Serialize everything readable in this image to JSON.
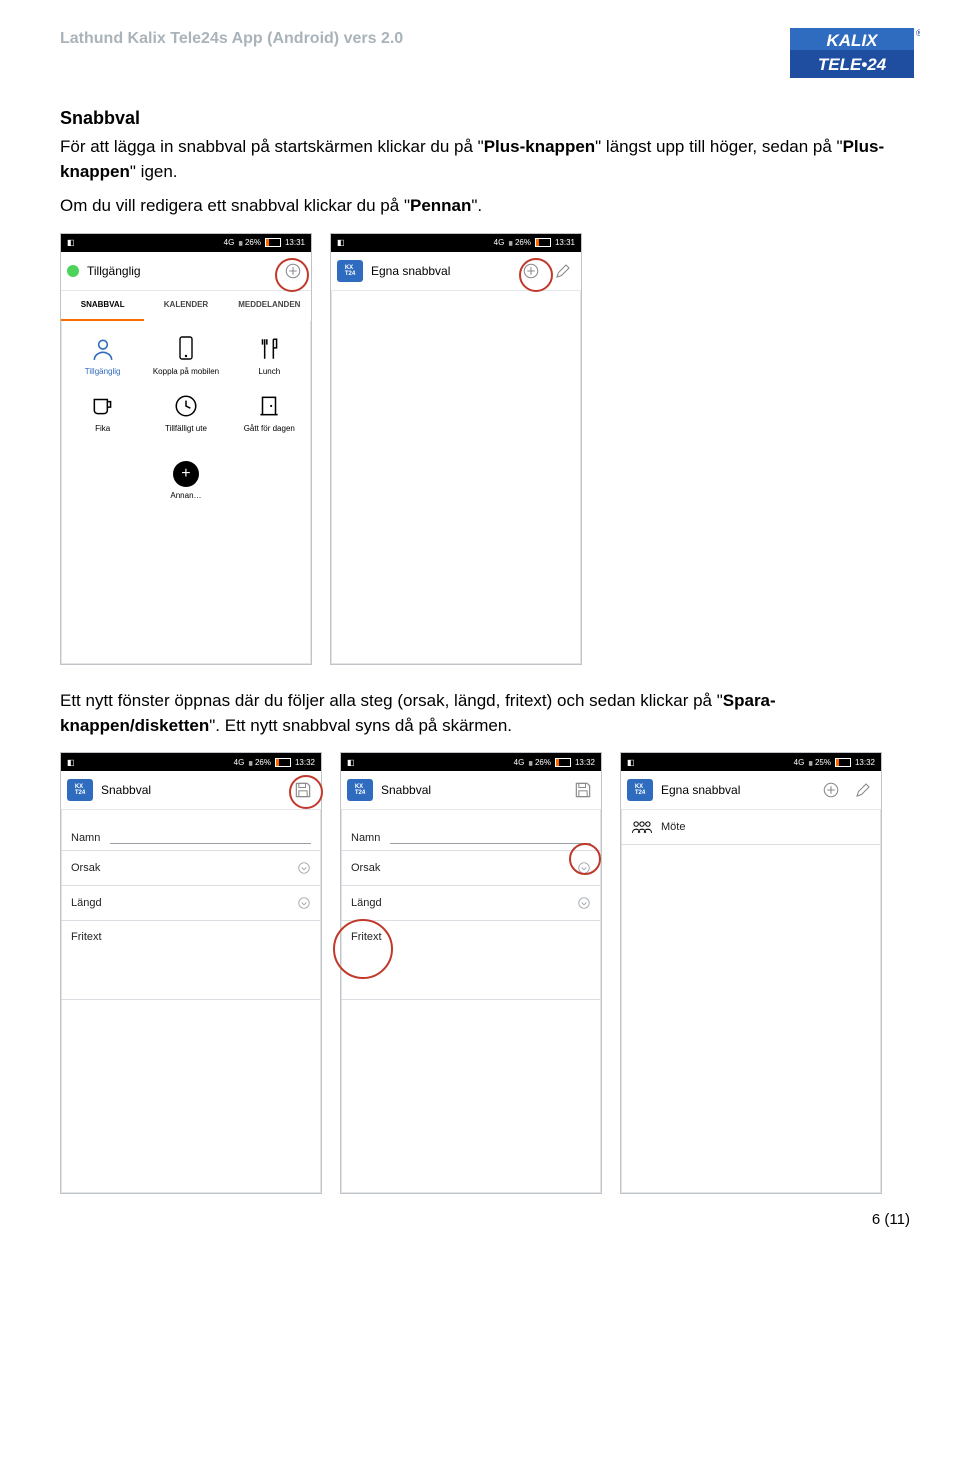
{
  "doc_header": "Lathund Kalix Tele24s App (Android) vers 2.0",
  "logo": {
    "line1": "KALIX",
    "line2": "TELE•24"
  },
  "section1": {
    "title": "Snabbval",
    "p1a": "För att lägga in snabbval på startskärmen klickar du på \"",
    "p1b": "Plus-knappen",
    "p1c": "\" längst upp till höger, sedan på \"",
    "p1d": "Plus-knappen",
    "p1e": "\" igen.",
    "p2a": "Om du vill redigera ett snabbval klickar du på \"",
    "p2b": "Pennan",
    "p2c": "\"."
  },
  "section2": {
    "p1a": "Ett nytt fönster öppnas där du följer alla steg (orsak, längd, fritext) och sedan klickar på \"",
    "p1b": "Spara-knappen/disketten",
    "p1c": "\". Ett nytt snabbval syns då på skärmen."
  },
  "status": {
    "pct": "26%",
    "pct2": "25%",
    "time": "13:31",
    "time2": "13:32",
    "net": "4G"
  },
  "screens": {
    "home": {
      "status": "Tillgänglig",
      "tabs": [
        "SNABBVAL",
        "KALENDER",
        "MEDDELANDEN"
      ],
      "cells": [
        {
          "label": "Tillgänglig",
          "icon": "person",
          "blue": true
        },
        {
          "label": "Koppla på mobilen",
          "icon": "phone"
        },
        {
          "label": "Lunch",
          "icon": "fork"
        },
        {
          "label": "Fika",
          "icon": "cup"
        },
        {
          "label": "Tillfälligt ute",
          "icon": "clock"
        },
        {
          "label": "Gått för dagen",
          "icon": "door"
        }
      ],
      "other": "Annan…"
    },
    "egna": {
      "title": "Egna snabbval"
    },
    "form": {
      "title": "Snabbval",
      "fields": {
        "namn": "Namn",
        "orsak": "Orsak",
        "langd": "Längd",
        "fritext": "Fritext"
      }
    },
    "result": {
      "title": "Egna snabbval",
      "item": "Möte"
    }
  },
  "footer": "6 (11)"
}
